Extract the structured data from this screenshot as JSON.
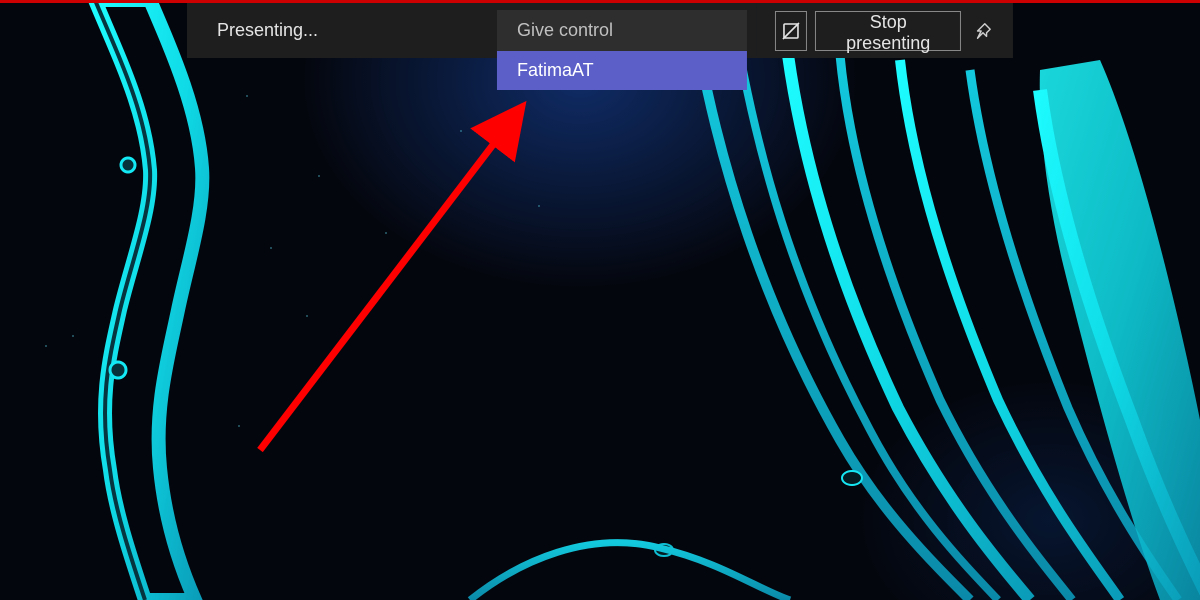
{
  "toolbar": {
    "status_label": "Presenting...",
    "give_control_label": "Give control",
    "give_control_options": [
      {
        "label": "FatimaAT"
      }
    ],
    "stop_label": "Stop presenting"
  },
  "icons": {
    "slashed_box": "include-system-audio-off-icon",
    "pin": "pin-icon"
  },
  "annotation": {
    "type": "arrow",
    "color": "#ff0000"
  }
}
